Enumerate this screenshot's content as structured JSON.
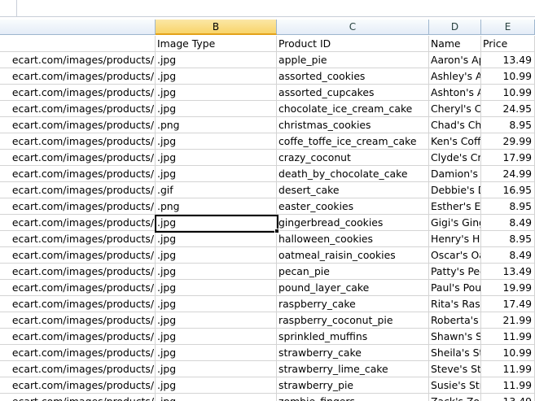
{
  "columns": [
    "",
    "B",
    "C",
    "D",
    "E"
  ],
  "headers": {
    "a": "",
    "b": "Image Type",
    "c": "Product ID",
    "d": "Name",
    "e": "Price"
  },
  "rows": [
    {
      "a": "ecart.com/images/products/",
      "b": ".jpg",
      "c": "apple_pie",
      "d": "Aaron's Apple Pie",
      "e": "13.49"
    },
    {
      "a": "ecart.com/images/products/",
      "b": ".jpg",
      "c": "assorted_cookies",
      "d": "Ashley's Assorted Cookies",
      "e": "10.99"
    },
    {
      "a": "ecart.com/images/products/",
      "b": ".jpg",
      "c": "assorted_cupcakes",
      "d": "Ashton's Assorted Cupcakes",
      "e": "10.99"
    },
    {
      "a": "ecart.com/images/products/",
      "b": ".jpg",
      "c": "chocolate_ice_cream_cake",
      "d": "Cheryl's Chocolate Ice Cream Cake",
      "e": "24.95"
    },
    {
      "a": "ecart.com/images/products/",
      "b": ".png",
      "c": "christmas_cookies",
      "d": "Chad's Christmas Cookies",
      "e": "8.95"
    },
    {
      "a": "ecart.com/images/products/",
      "b": ".jpg",
      "c": "coffe_toffe_ice_cream_cake",
      "d": "Ken's Coffee Toffee Ice Cream Cake",
      "e": "29.99"
    },
    {
      "a": "ecart.com/images/products/",
      "b": ".jpg",
      "c": "crazy_coconut",
      "d": "Clyde's Crazy Coconut",
      "e": "17.99"
    },
    {
      "a": "ecart.com/images/products/",
      "b": ".jpg",
      "c": "death_by_chocolate_cake",
      "d": "Damion's Death by Chocolate Cake",
      "e": "24.99"
    },
    {
      "a": "ecart.com/images/products/",
      "b": ".gif",
      "c": "desert_cake",
      "d": "Debbie's Desert Cake",
      "e": "16.95"
    },
    {
      "a": "ecart.com/images/products/",
      "b": ".png",
      "c": "easter_cookies",
      "d": "Esther's Easter Cookies",
      "e": "8.95"
    },
    {
      "a": "ecart.com/images/products/",
      "b": ".jpg",
      "c": "gingerbread_cookies",
      "d": "Gigi's Gingerbread Cookies",
      "e": "8.49"
    },
    {
      "a": "ecart.com/images/products/",
      "b": ".jpg",
      "c": "halloween_cookies",
      "d": "Henry's Halloween Cookies",
      "e": "8.95"
    },
    {
      "a": "ecart.com/images/products/",
      "b": ".jpg",
      "c": "oatmeal_raisin_cookies",
      "d": "Oscar's Oatmeal Raisin Cookies",
      "e": "8.49"
    },
    {
      "a": "ecart.com/images/products/",
      "b": ".jpg",
      "c": "pecan_pie",
      "d": "Patty's Pecan Pie",
      "e": "13.49"
    },
    {
      "a": "ecart.com/images/products/",
      "b": ".jpg",
      "c": "pound_layer_cake",
      "d": "Paul's Pound Layer Cake",
      "e": "19.99"
    },
    {
      "a": "ecart.com/images/products/",
      "b": ".jpg",
      "c": "raspberry_cake",
      "d": "Rita's Raspberry Cake",
      "e": "17.49"
    },
    {
      "a": "ecart.com/images/products/",
      "b": ".jpg",
      "c": "raspberry_coconut_pie",
      "d": "Roberta's Raspberry Coconut Pie",
      "e": "21.99"
    },
    {
      "a": "ecart.com/images/products/",
      "b": ".jpg",
      "c": "sprinkled_muffins",
      "d": "Shawn's Sprinkled Muffins",
      "e": "11.99"
    },
    {
      "a": "ecart.com/images/products/",
      "b": ".jpg",
      "c": "strawberry_cake",
      "d": "Sheila's Strawberry Cake",
      "e": "10.99"
    },
    {
      "a": "ecart.com/images/products/",
      "b": ".jpg",
      "c": "strawberry_lime_cake",
      "d": "Steve's Strawberry Lime Cake",
      "e": "11.99"
    },
    {
      "a": "ecart.com/images/products/",
      "b": ".jpg",
      "c": "strawberry_pie",
      "d": "Susie's Strawberry Pie",
      "e": "11.99"
    },
    {
      "a": "ecart.com/images/products/",
      "b": ".jpg",
      "c": "zombie_fingers",
      "d": "Zack's Zombie Fingers",
      "e": "13.49"
    }
  ],
  "active_cell": {
    "column": "B",
    "row_index": 10
  },
  "colors": {
    "selected_header": "#f8d46a",
    "gridline": "#d4d4d4",
    "header_border": "#9eb6ce"
  }
}
